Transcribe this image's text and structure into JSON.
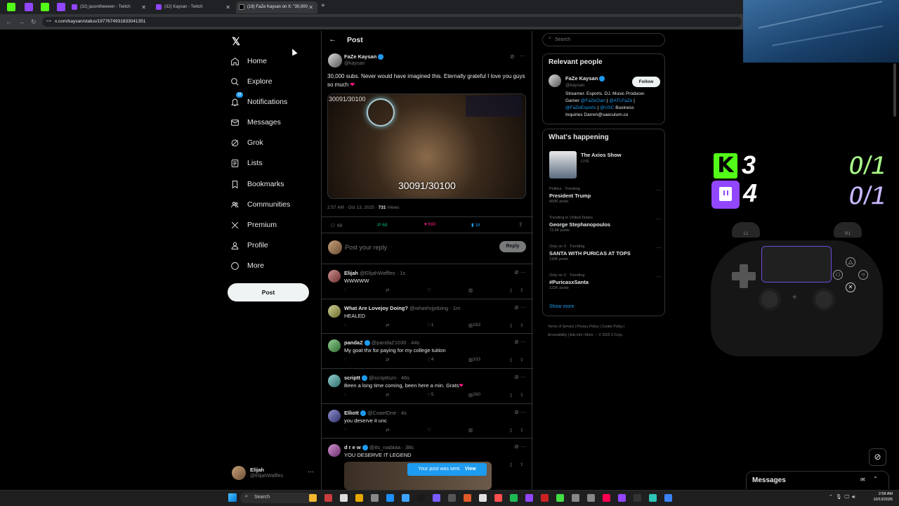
{
  "browser": {
    "tabs": [
      {
        "label": "(32) jasontheween - Twitch"
      },
      {
        "label": "(32) Kaysan - Twitch"
      },
      {
        "label": "(18) FaZe Kaysan on X: \"30,000"
      }
    ],
    "url": "x.com/kaysan/status/1977674931833041351"
  },
  "sidebar": {
    "items": [
      {
        "label": "Home",
        "icon": "home-icon"
      },
      {
        "label": "Explore",
        "icon": "search-icon"
      },
      {
        "label": "Notifications",
        "icon": "bell-icon",
        "badge": "18"
      },
      {
        "label": "Messages",
        "icon": "mail-icon"
      },
      {
        "label": "Grok",
        "icon": "grok-icon"
      },
      {
        "label": "Lists",
        "icon": "list-icon"
      },
      {
        "label": "Bookmarks",
        "icon": "bookmark-icon"
      },
      {
        "label": "Communities",
        "icon": "people-icon"
      },
      {
        "label": "Premium",
        "icon": "x-logo-icon"
      },
      {
        "label": "Profile",
        "icon": "person-icon"
      },
      {
        "label": "More",
        "icon": "more-circle-icon"
      }
    ],
    "post_label": "Post",
    "account": {
      "name": "Elijah",
      "handle": "@ElijahWaffles"
    }
  },
  "main": {
    "header": "Post",
    "post": {
      "author": "FaZe Kaysan",
      "handle": "@kaysan",
      "text": "30,000 subs. Never would have imagined this. Eternally grateful I love you guys so much",
      "image_overlay_top": "30091/30100",
      "image_counter": "30091/30100",
      "time": "2:57 AM · Oct 13, 2025 · ",
      "views_count": "731",
      "views_label": " Views",
      "stats": {
        "replies": "69",
        "reposts": "69",
        "likes": "690",
        "bookmarks": "16"
      }
    },
    "reply_box": {
      "placeholder": "Post your reply",
      "button": "Reply"
    },
    "replies": [
      {
        "name": "Elijah",
        "handle": "@ElijahWaffles · 1s",
        "text": "WWWWW",
        "likes": "",
        "views": ""
      },
      {
        "name": "What Are Lovejoy Doing?",
        "handle": "@whatrlvjydoing · 1m",
        "text": "HEALED",
        "likes": "1",
        "views": "163"
      },
      {
        "name": "pandaZ",
        "handle": "@pandaZ1030 · 44s",
        "text": "My goat thx for paying for my college tuition",
        "likes": "4",
        "views": "333"
      },
      {
        "name": "scriptt",
        "handle": "@scripttszn · 46s",
        "text": "Been a long time coming, been here a min. Grats",
        "likes": "5",
        "views": "260"
      },
      {
        "name": "Elliott",
        "handle": "@CoaelOne · 4s",
        "text": "you deserve it unc",
        "likes": "",
        "views": ""
      },
      {
        "name": "d r e w",
        "handle": "@its_nadaaa · 38s",
        "text": "YOU DESERVE IT LEGEND",
        "likes": "",
        "views": ""
      }
    ],
    "toast": {
      "text": "Your post was sent.",
      "action": "View"
    }
  },
  "right": {
    "search_placeholder": "Search",
    "relevant": {
      "title": "Relevant people",
      "name": "FaZe Kaysan",
      "handle": "@kaysan",
      "follow": "Follow",
      "bio_1": "Streamer. Esports. DJ. Music Producer.",
      "bio_2a": "Gamer ",
      "bio_2b": "@FaZeClan",
      "bio_2c": " | ",
      "bio_2d": "@ATLFaZe",
      "bio_2e": " |",
      "bio_3a": "@FaZeEsports",
      "bio_3b": " | ",
      "bio_3c": "@USC",
      "bio_3d": " Business",
      "bio_4": "Inquiries Darren@saeculum.co"
    },
    "happening": {
      "title": "What's happening",
      "live_title": "The Axios Show",
      "live_badge": "LIVE",
      "trends": [
        {
          "context": "Politics · Trending",
          "name": "President Trump",
          "posts": "660K posts"
        },
        {
          "context": "Trending in United States",
          "name": "George Stephanopoulos",
          "posts": "73.6K posts"
        },
        {
          "context": "Only on X · Trending",
          "name": "SANTA WITH PURICAS AT TOPS",
          "posts": "116K posts"
        },
        {
          "context": "Only on X · Trending",
          "name": "#PuricasxSanta",
          "posts": "122K posts"
        }
      ],
      "show_more": "Show more"
    },
    "footer_1": "Terms of Service  |  Privacy Policy  |  Cookie Policy  |",
    "footer_2": "Accessibility  |  Ads info  |  More ···  © 2025 X Corp."
  },
  "overlay": {
    "kick_count": "3",
    "twitch_count": "4",
    "score_top": "0/1",
    "score_bottom": "0/1",
    "controller_l1": "L1",
    "controller_r1": "R1"
  },
  "messages_drawer": {
    "label": "Messages"
  },
  "taskbar": {
    "search": "Search",
    "time": "2:58 AM",
    "date": "10/13/2025"
  },
  "colors": {
    "accent": "#1d9bf0",
    "kick": "#53fc18",
    "twitch": "#9146ff",
    "like": "#f91880",
    "repost": "#00ba7c"
  }
}
